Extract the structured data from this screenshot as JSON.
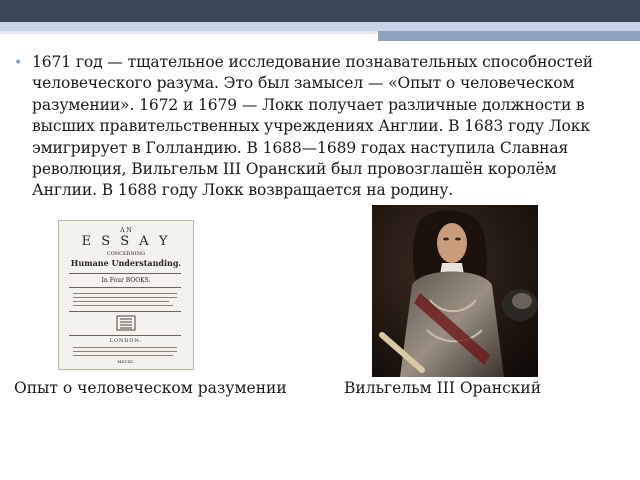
{
  "paragraph": "1671 год — тщательное исследование познавательных способностей человеческого разума. Это был замысел  — «Опыт о человеческом разумении». 1672 и 1679 — Локк получает различные должности в высших правительственных учреждениях Англии. В 1683 году Локк эмигрирует в Голландию. В 1688—1689 годах наступила Славная революция, Вильгельм III Оранский был провозглашён королём Англии. В 1688 году Локк возвращается на родину.",
  "captions": {
    "book": "Опыт о человеческом разумении",
    "portrait": "Вильгельм III Оранский"
  },
  "book_title_page": {
    "an": "A N",
    "essay": "E S S A Y",
    "concerning": "CONCERNING",
    "subject": "Humane Understanding.",
    "books": "In Four BOOKS.",
    "london": "LONDON:",
    "year": "MDCXC."
  },
  "colors": {
    "topbar": "#3c4659",
    "stripe_light": "#c9d5e6",
    "stripe_mid": "#8ea2bd"
  }
}
